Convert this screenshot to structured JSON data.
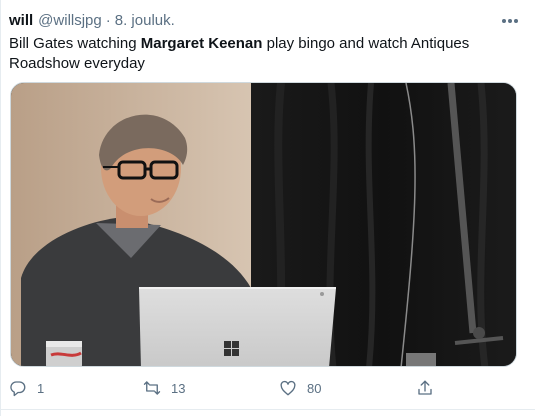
{
  "tweet": {
    "author_name": "will",
    "author_handle": "@willsjpg",
    "separator": "·",
    "date": "8. jouluk.",
    "text_part1": "Bill Gates watching ",
    "text_bold": "Margaret Keenan",
    "text_part2": " play bingo and watch Antiques Roadshow everyday",
    "actions": {
      "reply_count": "1",
      "retweet_count": "13",
      "like_count": "80"
    }
  },
  "colors": {
    "text": "#0f1419",
    "secondary": "#5b7083",
    "border": "#cfd9de"
  },
  "icons": {
    "more": "more-icon",
    "reply": "reply-icon",
    "retweet": "retweet-icon",
    "like": "like-icon",
    "share": "share-icon"
  }
}
